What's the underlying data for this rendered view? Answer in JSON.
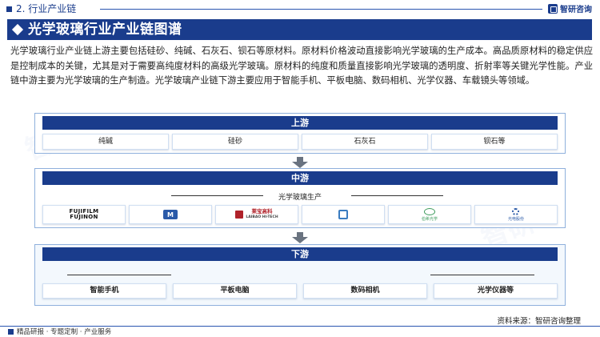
{
  "header": {
    "section_title": "2. 行业产业链",
    "logo_text": "智研咨询"
  },
  "banner": {
    "title": "光学玻璃行业产业链图谱"
  },
  "intro": "光学玻璃行业产业链上游主要包括硅砂、纯碱、石灰石、钡石等原材料。原材料价格波动直接影响光学玻璃的生产成本。高品质原材料的稳定供应是控制成本的关键，尤其是对于需要高纯度材料的高级光学玻璃。原材料的纯度和质量直接影响光学玻璃的透明度、折射率等关键光学性能。产业链中游主要为光学玻璃的生产制造。光学玻璃产业链下游主要应用于智能手机、平板电脑、数码相机、光学仪器、车载镜头等领域。",
  "upstream": {
    "title": "上游",
    "items": [
      "纯碱",
      "硅砂",
      "石灰石",
      "钡石等"
    ]
  },
  "midstream": {
    "title": "中游",
    "label": "光学玻璃生产",
    "logos": [
      {
        "line1": "FUJIFILM",
        "line2": "FUJINON"
      },
      {
        "mark": "M"
      },
      {
        "name": "莱宝高科",
        "sub": "LAIBAO HI-TECH"
      },
      {
        "mark": ""
      },
      {
        "name": "伯希光学"
      },
      {
        "name": "光电股份"
      }
    ]
  },
  "downstream": {
    "title": "下游",
    "items": [
      "智能手机",
      "平板电脑",
      "数码相机",
      "光学仪器等"
    ]
  },
  "source": "资料来源：智研咨询整理",
  "footer": "精品研报 · 专题定制 · 产业服务"
}
